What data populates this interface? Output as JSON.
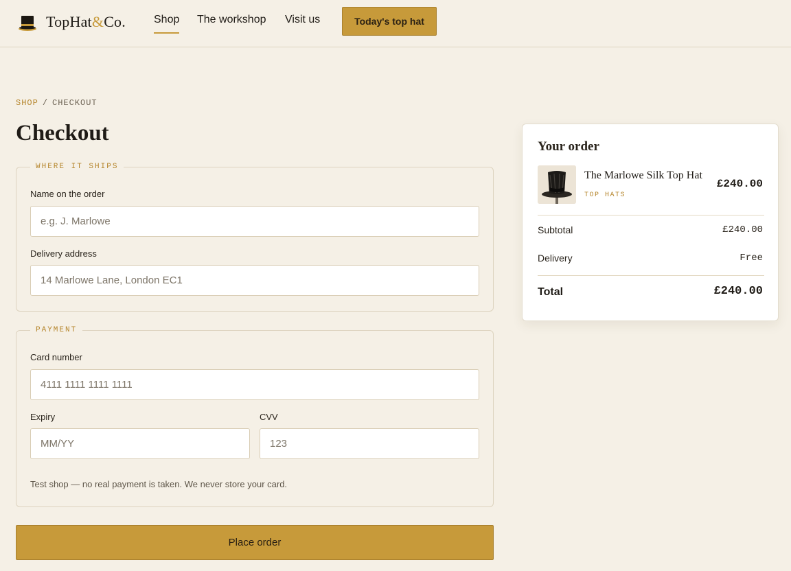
{
  "brand": {
    "name_main": "TopHat",
    "name_amp": "&",
    "name_end": "Co.",
    "logo_icon": "top-hat-icon"
  },
  "nav": {
    "items": [
      {
        "label": "Shop",
        "active": true
      },
      {
        "label": "The workshop",
        "active": false
      },
      {
        "label": "Visit us",
        "active": false
      }
    ],
    "cta_label": "Today's top hat"
  },
  "breadcrumb": {
    "link": "SHOP",
    "separator": "/",
    "current": "CHECKOUT"
  },
  "page_title": "Checkout",
  "shipping": {
    "legend": "WHERE IT SHIPS",
    "name_label": "Name on the order",
    "name_placeholder": "e.g. J. Marlowe",
    "address_label": "Delivery address",
    "address_placeholder": "14 Marlowe Lane, London EC1"
  },
  "payment": {
    "legend": "PAYMENT",
    "card_label": "Card number",
    "card_placeholder": "4111 1111 1111 1111",
    "expiry_label": "Expiry",
    "expiry_placeholder": "MM/YY",
    "cvv_label": "CVV",
    "cvv_placeholder": "123",
    "hint": "Test shop — no real payment is taken. We never store your card."
  },
  "place_order_label": "Place order",
  "order": {
    "title": "Your order",
    "item": {
      "name": "The Marlowe Silk Top Hat",
      "category": "TOP HATS",
      "price": "£240.00",
      "image_icon": "top-hat-photo"
    },
    "subtotal_label": "Subtotal",
    "subtotal_value": "£240.00",
    "delivery_label": "Delivery",
    "delivery_value": "Free",
    "total_label": "Total",
    "total_value": "£240.00"
  },
  "colors": {
    "accent": "#c79a3a",
    "background": "#f5f0e6",
    "card": "#ffffff",
    "text": "#1f1b16"
  }
}
